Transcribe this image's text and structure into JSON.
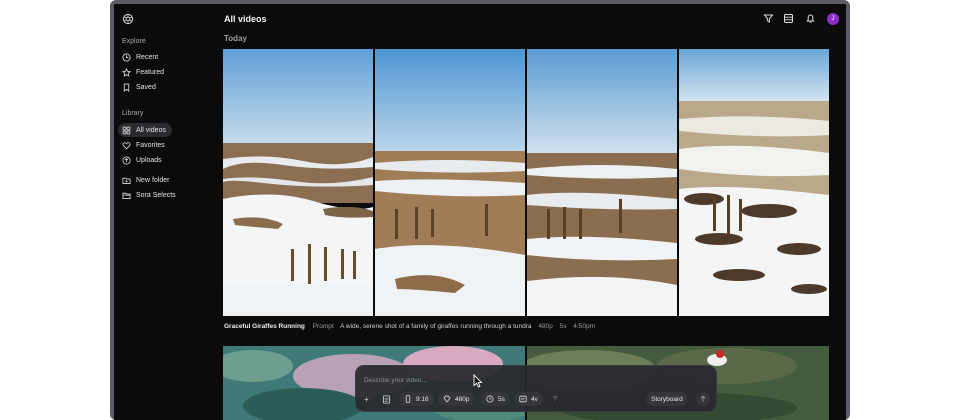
{
  "sidebar": {
    "explore_label": "Explore",
    "explore_items": [
      {
        "label": "Recent",
        "icon": "clock-icon"
      },
      {
        "label": "Featured",
        "icon": "star-icon"
      },
      {
        "label": "Saved",
        "icon": "bookmark-icon"
      }
    ],
    "library_label": "Library",
    "library_items": [
      {
        "label": "All videos",
        "icon": "grid-icon",
        "active": true
      },
      {
        "label": "Favorites",
        "icon": "heart-icon"
      },
      {
        "label": "Uploads",
        "icon": "upload-icon"
      }
    ],
    "folders": [
      {
        "label": "New folder",
        "icon": "folder-plus-icon"
      },
      {
        "label": "Sora Selects",
        "icon": "folder-icon"
      }
    ]
  },
  "header": {
    "title": "All videos",
    "avatar_initial": "J"
  },
  "section": {
    "title": "Today"
  },
  "video": {
    "title": "Graceful Giraffes Running",
    "prompt_label": "Prompt",
    "prompt": "A wide, serene shot of a family of giraffes running through a tundra",
    "resolution": "480p",
    "duration": "5s",
    "time": "4:50pm"
  },
  "composer": {
    "placeholder": "Describe your video...",
    "add_label": "+",
    "aspect": "9:16",
    "resolution": "480p",
    "duration": "5s",
    "variations": "4v",
    "help": "?",
    "storyboard": "Storyboard"
  },
  "colors": {
    "background": "#0b0b0c",
    "accent_avatar": "#8b2fc9",
    "sky": "#7fb4e0",
    "snow": "#f2f4f6",
    "earth": "#8a6d4c"
  }
}
